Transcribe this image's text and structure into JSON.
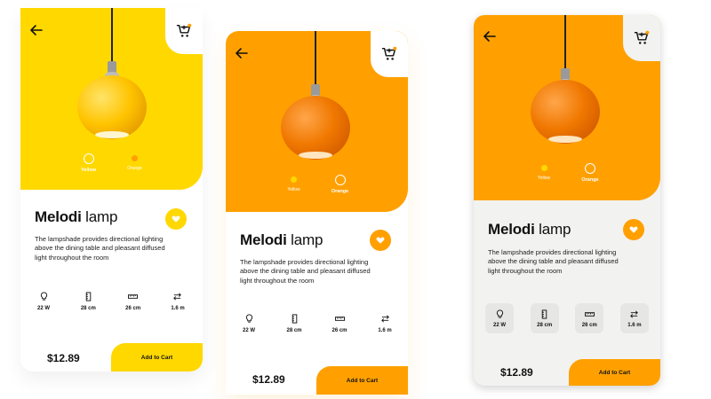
{
  "product": {
    "name_bold": "Melodi",
    "name_rest": " lamp",
    "description": "The lampshade provides directional lighting above the dining table and pleasant diffused light throughout the room",
    "price": "$12.89",
    "add_to_cart_label": "Add to Cart",
    "specs": [
      {
        "icon": "bulb-icon",
        "value": "22 W"
      },
      {
        "icon": "height-icon",
        "value": "28 cm"
      },
      {
        "icon": "ruler-icon",
        "value": "26 cm"
      },
      {
        "icon": "swap-arrows-icon",
        "value": "1.6 m"
      }
    ],
    "colors": [
      {
        "label": "Yellow",
        "hex": "#ffd800"
      },
      {
        "label": "Orange",
        "hex": "#ffa000"
      }
    ]
  },
  "theme": {
    "yellow": "#ffd800",
    "orange": "#ffa000",
    "heart_yellow": "#ffd800",
    "heart_orange": "#ffa000",
    "cart_badge": "#ffa000"
  },
  "variants": [
    {
      "selected_color": "Yellow"
    },
    {
      "selected_color": "Orange"
    },
    {
      "selected_color": "Orange"
    }
  ]
}
